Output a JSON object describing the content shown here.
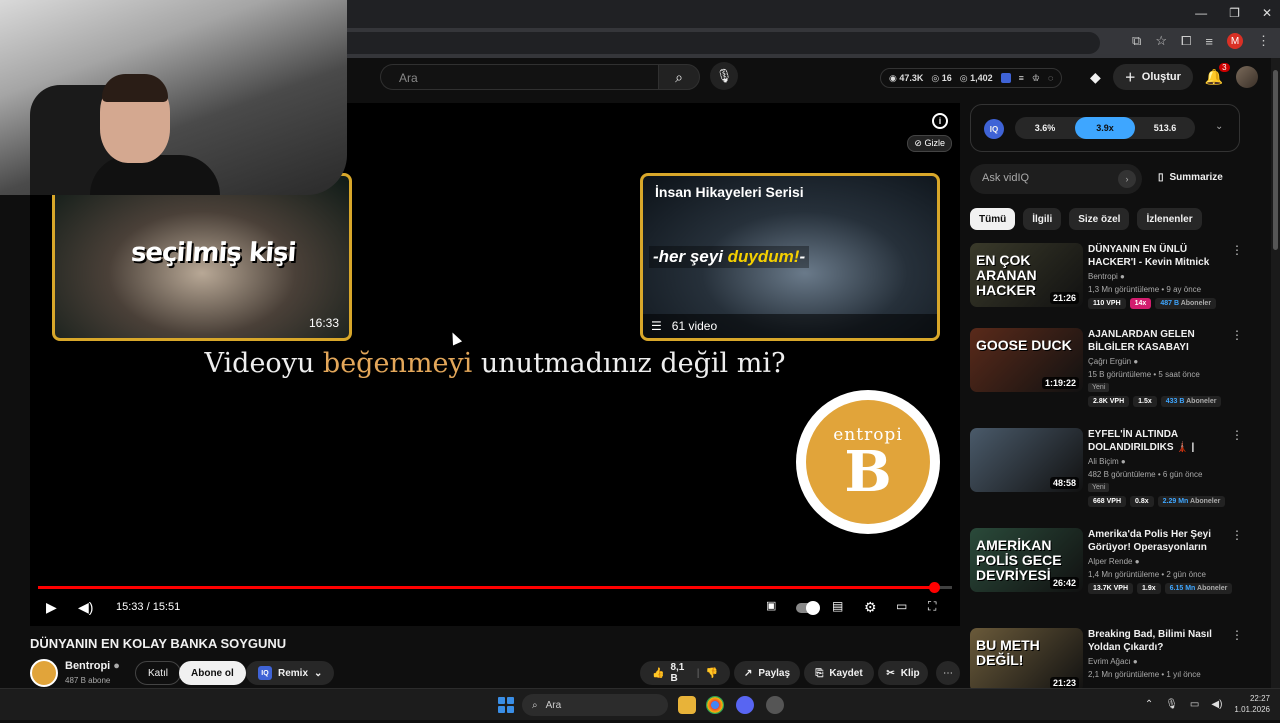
{
  "browser": {
    "window_controls": [
      "—",
      "❐",
      "✕"
    ],
    "profile_initial": "M"
  },
  "header": {
    "search_placeholder": "Ara",
    "stats": [
      "47.3K",
      "16",
      "1,402"
    ],
    "create_label": "Oluştur",
    "notifications_count": "3"
  },
  "player": {
    "end_card_left": {
      "title": "seçilmiş kişi",
      "duration": "16:33"
    },
    "end_card_right": {
      "title": "İnsan Hikayeleri Serisi",
      "tag_part1": "-her şeyi ",
      "tag_part2": "duydum!",
      "tag_part3": "-",
      "playlist_count": "61 video"
    },
    "caption_part1": "Videoyu ",
    "caption_accent": "beğenmeyi",
    "caption_part2": " unutmadınız değil mi?",
    "logo_word": "entropi",
    "logo_letter": "B",
    "hide_label": "Gizle",
    "time": "15:33 / 15:51",
    "progress_fraction": 0.98
  },
  "video": {
    "title": "DÜNYANIN EN KOLAY BANKA SOYGUNU",
    "channel_name": "Bentropi",
    "subscribers": "487 B abone",
    "join_label": "Katıl",
    "subscribe_label": "Abone ol",
    "remix_label": "Remix",
    "likes": "8,1 B",
    "share_label": "Paylaş",
    "save_label": "Kaydet",
    "clip_label": "Klip"
  },
  "sidebar": {
    "iq_stats": [
      "3.6%",
      "3.9x",
      "513.6"
    ],
    "ask_placeholder": "Ask vidIQ",
    "summarize_label": "Summarize",
    "chips": [
      "Tümü",
      "İlgili",
      "Size özel",
      "İzlenenler"
    ],
    "recommendations": [
      {
        "title": "DÜNYANIN EN ÜNLÜ HACKER'I - Kevin Mitnick",
        "channel": "Bentropi",
        "meta": "1,3 Mn görüntüleme • 9 ay önce",
        "duration": "21:26",
        "thumb_text": "EN ÇOK ARANAN HACKER",
        "vph": "110 VPH",
        "mult": "14x",
        "subs": "487 B",
        "subs_label": "Aboneler",
        "new": "",
        "thumb_color": "#3a3a2a"
      },
      {
        "title": "AJANLARDAN GELEN BİLGİLER KASABAYI TEHLİKEYE SOKTU!...",
        "channel": "Çağrı Ergün",
        "meta": "15 B görüntüleme • 5 saat önce",
        "duration": "1:19:22",
        "thumb_text": "GOOSE DUCK",
        "vph": "2.8K VPH",
        "mult": "1.5x",
        "subs": "433 B",
        "subs_label": "Aboneler",
        "new": "Yeni",
        "thumb_color": "#5a2a1a"
      },
      {
        "title": "EYFEL'İN ALTINDA DOLANDIRILDIKS 🗼 | PARİS ...",
        "channel": "Ali Biçim",
        "meta": "482 B görüntüleme • 6 gün önce",
        "duration": "48:58",
        "thumb_text": "",
        "vph": "668 VPH",
        "mult": "0.8x",
        "subs": "2.29 Mn",
        "subs_label": "Aboneler",
        "new": "Yeni",
        "thumb_color": "#4a5a6a"
      },
      {
        "title": "Amerika'da Polis Her Şeyi Görüyor! Operasyonların Perde...",
        "channel": "Alper Rende",
        "meta": "1,4 Mn görüntüleme • 2 gün önce",
        "duration": "26:42",
        "thumb_text": "AMERİKAN POLİS GECE DEVRİYESİ",
        "vph": "13.7K VPH",
        "mult": "1.9x",
        "subs": "6.15 Mn",
        "subs_label": "Aboneler",
        "new": "",
        "thumb_color": "#2a4a3a"
      },
      {
        "title": "Breaking Bad, Bilimi Nasıl Yoldan Çıkardı?",
        "channel": "Evrim Ağacı",
        "meta": "2,1 Mn görüntüleme • 1 yıl önce",
        "duration": "21:23",
        "thumb_text": "BU METH DEĞİL!",
        "vph": "",
        "mult": "",
        "subs": "",
        "subs_label": "",
        "new": "",
        "thumb_color": "#6a5a3a"
      }
    ]
  },
  "taskbar": {
    "search_label": "Ara",
    "time": "22:27",
    "date": "1.01.2026"
  }
}
